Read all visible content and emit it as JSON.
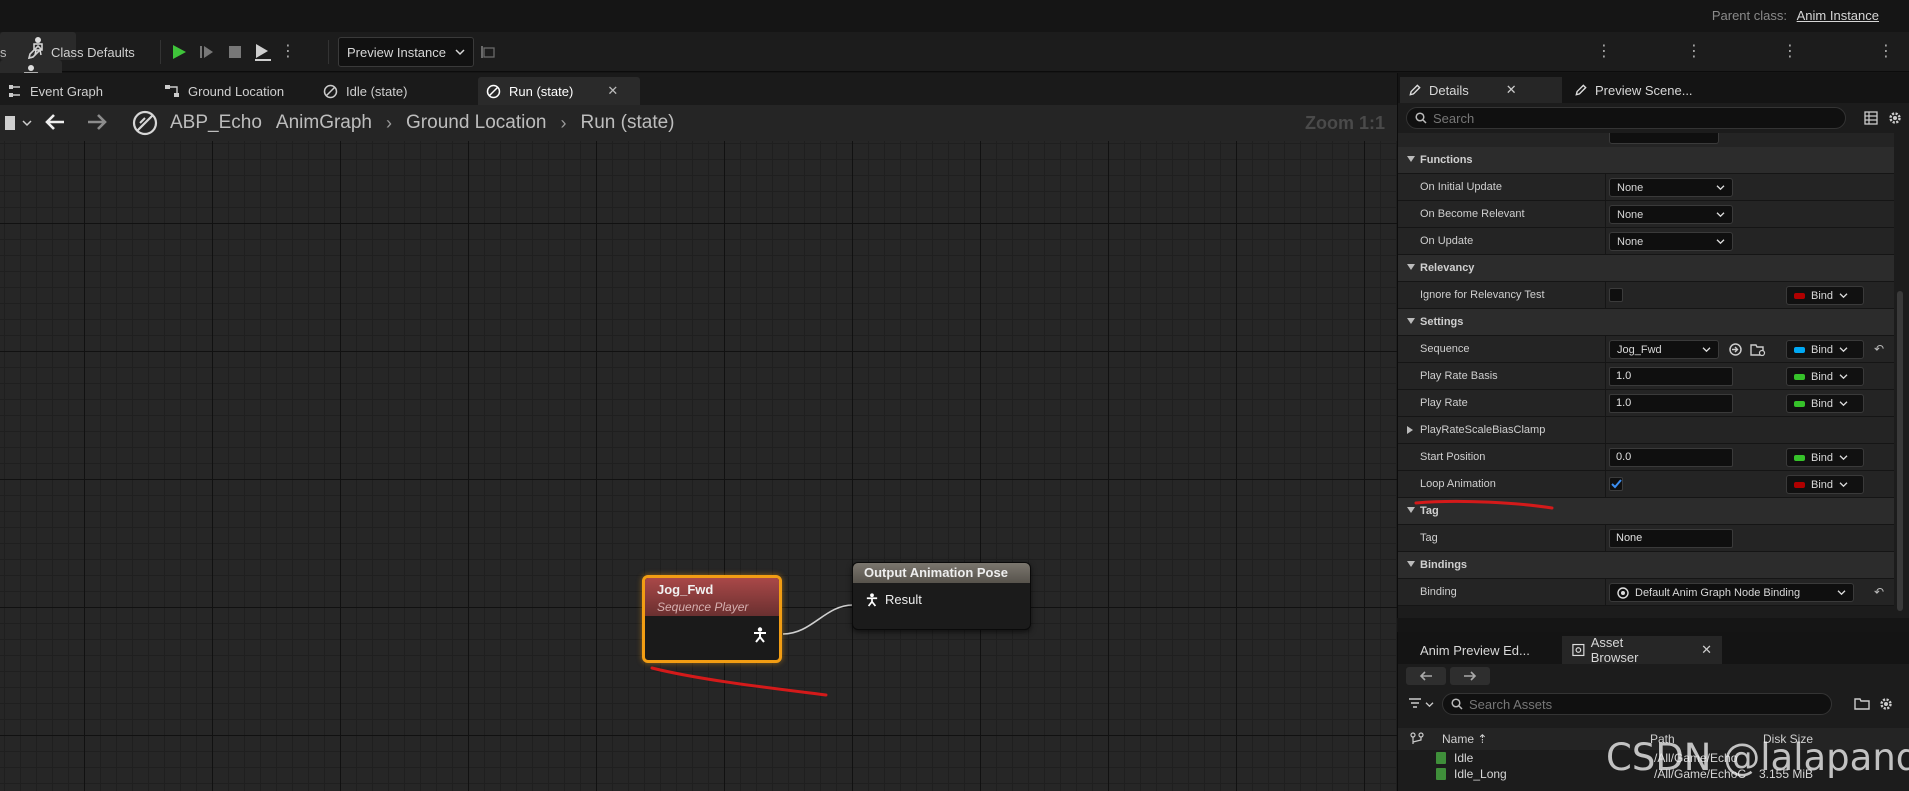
{
  "header": {
    "parent_class_label": "Parent class:",
    "parent_class_value": "Anim Instance"
  },
  "toolbar": {
    "class_defaults": "Class Defaults",
    "preview_instance": "Preview Instance"
  },
  "editor_tabs": [
    {
      "label": "Event Graph"
    },
    {
      "label": "Ground Location"
    },
    {
      "label": "Idle (state)"
    },
    {
      "label": "Run (state)"
    }
  ],
  "breadcrumb": {
    "items": [
      "ABP_Echo",
      "AnimGraph",
      "Ground Location",
      "Run (state)"
    ]
  },
  "graph": {
    "zoom": "Zoom 1:1",
    "nodes": {
      "jog": {
        "title": "Jog_Fwd",
        "subtitle": "Sequence Player"
      },
      "output": {
        "title": "Output Animation Pose",
        "pin": "Result"
      }
    }
  },
  "details": {
    "tabs": [
      {
        "label": "Details"
      },
      {
        "label": "Preview Scene..."
      }
    ],
    "search_placeholder": "Search",
    "categories": {
      "functions": "Functions",
      "relevancy": "Relevancy",
      "settings": "Settings",
      "tag": "Tag",
      "bindings": "Bindings"
    },
    "props": {
      "on_initial_update": {
        "label": "On Initial Update",
        "value": "None"
      },
      "on_become_relevant": {
        "label": "On Become Relevant",
        "value": "None"
      },
      "on_update": {
        "label": "On Update",
        "value": "None"
      },
      "ignore_relevancy": {
        "label": "Ignore for Relevancy Test",
        "checked": false
      },
      "sequence": {
        "label": "Sequence",
        "value": "Jog_Fwd"
      },
      "play_rate_basis": {
        "label": "Play Rate Basis",
        "value": "1.0"
      },
      "play_rate": {
        "label": "Play Rate",
        "value": "1.0"
      },
      "play_rate_clamp": {
        "label": "PlayRateScaleBiasClamp"
      },
      "start_position": {
        "label": "Start Position",
        "value": "0.0"
      },
      "loop_animation": {
        "label": "Loop Animation",
        "checked": true
      },
      "tag": {
        "label": "Tag",
        "value": "None"
      },
      "binding": {
        "label": "Binding",
        "value": "Default Anim Graph Node Binding"
      }
    },
    "bind_label": "Bind",
    "bind_colors": {
      "bool": "#b00000",
      "object": "#00a8f3",
      "float": "#36c22a"
    }
  },
  "asset_browser": {
    "tabs": [
      {
        "label": "Anim Preview Ed..."
      },
      {
        "label": "Asset Browser"
      }
    ],
    "search_placeholder": "Search Assets",
    "columns": {
      "name": "Name",
      "path": "Path",
      "size": "Disk Size"
    },
    "rows": [
      {
        "name": "Idle",
        "path": "/All/Game/Echo",
        "size": ""
      },
      {
        "name": "Idle_Long",
        "path": "/All/Game/EchoC",
        "size": "3.155 MiB"
      }
    ]
  },
  "watermark": "CSDN @lalapanda"
}
